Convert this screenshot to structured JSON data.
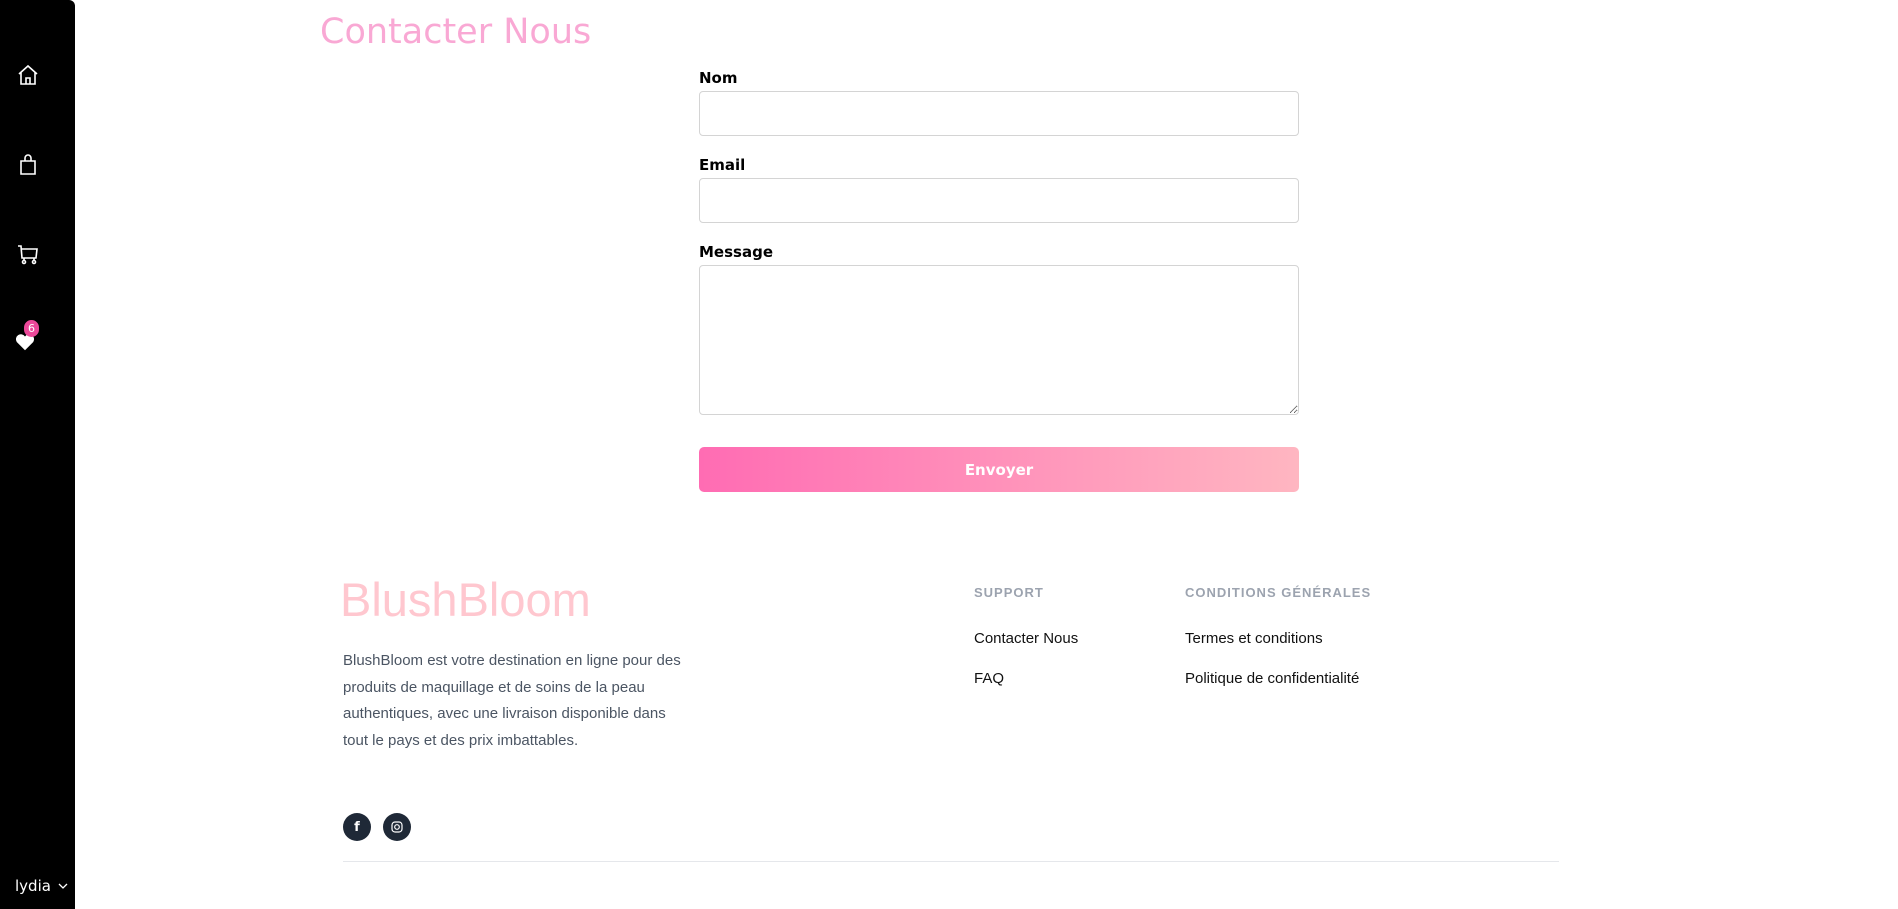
{
  "sidebar": {
    "items": [
      {
        "icon": "home-icon"
      },
      {
        "icon": "shopping-bag-icon"
      },
      {
        "icon": "cart-icon"
      },
      {
        "icon": "heart-icon",
        "badge": "6"
      }
    ],
    "user": {
      "name": "lydia",
      "icon": "chevron-down-icon"
    }
  },
  "page": {
    "title": "Contacter Nous"
  },
  "form": {
    "name_label": "Nom",
    "name_value": "",
    "email_label": "Email",
    "email_value": "",
    "message_label": "Message",
    "message_value": "",
    "submit_label": "Envoyer"
  },
  "footer": {
    "brand": "BlushBloom",
    "description": "BlushBloom est votre destination en ligne pour des produits de maquillage et de soins de la peau authentiques, avec une livraison disponible dans tout le pays et des prix imbattables.",
    "social": [
      {
        "icon": "facebook-icon",
        "glyph": "f"
      },
      {
        "icon": "instagram-icon"
      }
    ],
    "support": {
      "title": "SUPPORT",
      "links": [
        "Contacter Nous",
        "FAQ"
      ]
    },
    "conditions": {
      "title": "CONDITIONS GÉNÉRALES",
      "links": [
        "Termes et conditions",
        "Politique de confidentialité"
      ]
    }
  },
  "colors": {
    "accent": "#f9a8d4",
    "badge": "#ec4899",
    "button_start": "#ff6cb3",
    "button_end": "#ffb6c1",
    "brand": "#ffc7cf"
  }
}
